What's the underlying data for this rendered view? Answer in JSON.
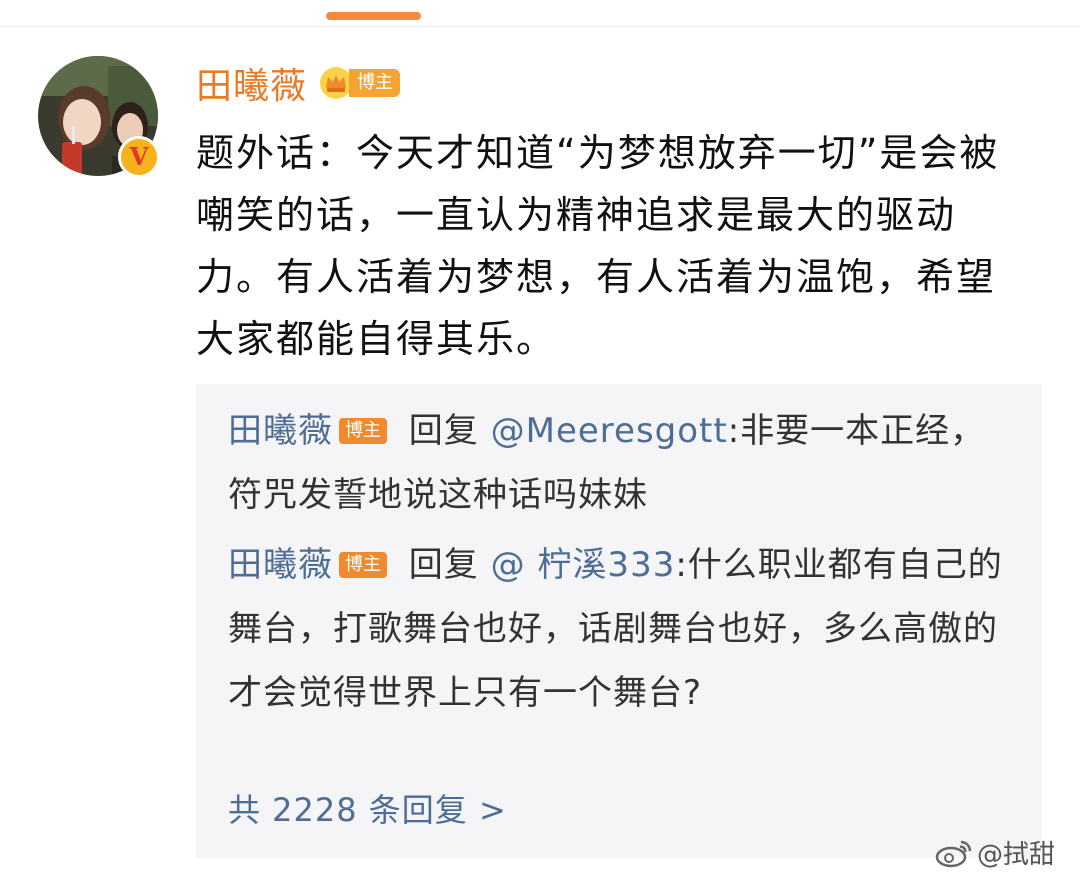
{
  "post": {
    "author": "田曦薇",
    "author_badge": "博主",
    "text": "题外话：今天才知道“为梦想放弃一切”是会被嘲笑的话，一直认为精神追求是最大的驱动力。有人活着为梦想，有人活着为温饱，希望大家都能自得其乐。"
  },
  "replies": {
    "items": [
      {
        "name": "田曦薇",
        "badge": "博主",
        "action": " 回复 ",
        "mention": "@Meeresgott",
        "text": ":非要一本正经，符咒发誓地说这种话吗妹妹"
      },
      {
        "name": "田曦薇",
        "badge": "博主",
        "action": " 回复 ",
        "mention": "@ 柠溪333",
        "text": ":什么职业都有自己的舞台，打歌舞台也好，话剧舞台也好，多么高傲的才会觉得世界上只有一个舞台?"
      }
    ],
    "more": "共 2228 条回复 >"
  },
  "watermark": {
    "text": "@拭甜",
    "icon": "weibo-icon"
  },
  "colors": {
    "author_name": "#ec7a25",
    "link_blue": "#4e6d95",
    "badge_orange": "#f08a2c",
    "reply_bg": "#f5f5f7",
    "top_indicator": "#f38a3c"
  }
}
